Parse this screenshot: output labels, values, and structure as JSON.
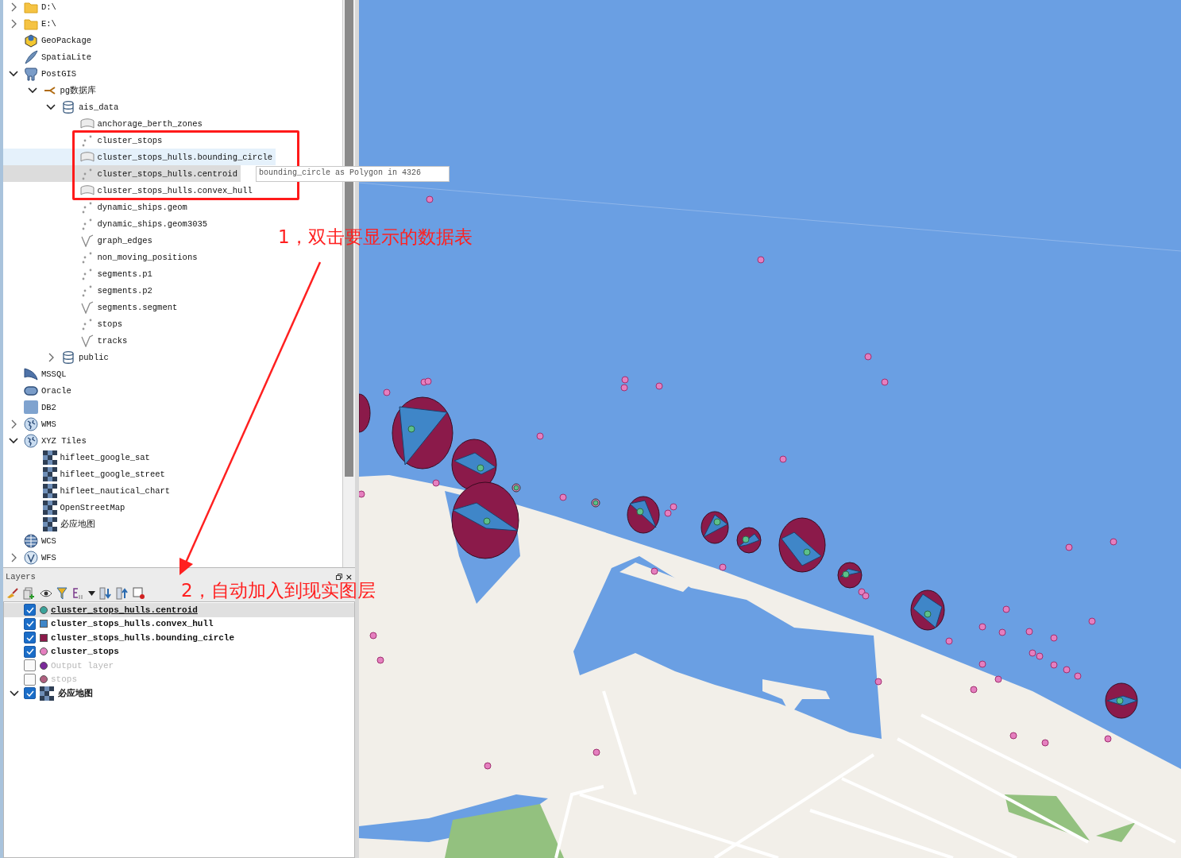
{
  "browser": {
    "tree": [
      {
        "label": "D:\\",
        "kind": "folder",
        "expanded": false
      },
      {
        "label": "E:\\",
        "kind": "folder",
        "expanded": false
      },
      {
        "label": "GeoPackage",
        "kind": "geopackage"
      },
      {
        "label": "SpatiaLite",
        "kind": "spatialite"
      },
      {
        "label": "PostGIS",
        "kind": "postgis",
        "expanded": true,
        "children": [
          {
            "label": "pg数据库",
            "kind": "connection",
            "expanded": true,
            "children": [
              {
                "label": "ais_data",
                "kind": "schema",
                "expanded": true,
                "children": [
                  {
                    "label": "anchorage_berth_zones",
                    "kind": "polygon",
                    "selected": false,
                    "hovered": false
                  },
                  {
                    "label": "cluster_stops",
                    "kind": "point",
                    "selected": false,
                    "hovered": false
                  },
                  {
                    "label": "cluster_stops_hulls.bounding_circle",
                    "kind": "polygon",
                    "selected": false,
                    "hovered": true
                  },
                  {
                    "label": "cluster_stops_hulls.centroid",
                    "kind": "point",
                    "selected": true,
                    "hovered": false
                  },
                  {
                    "label": "cluster_stops_hulls.convex_hull",
                    "kind": "polygon",
                    "selected": false,
                    "hovered": false
                  },
                  {
                    "label": "dynamic_ships.geom",
                    "kind": "point",
                    "selected": false,
                    "hovered": false
                  },
                  {
                    "label": "dynamic_ships.geom3035",
                    "kind": "point",
                    "selected": false,
                    "hovered": false
                  },
                  {
                    "label": "graph_edges",
                    "kind": "line",
                    "selected": false,
                    "hovered": false
                  },
                  {
                    "label": "non_moving_positions",
                    "kind": "point",
                    "selected": false,
                    "hovered": false
                  },
                  {
                    "label": "segments.p1",
                    "kind": "point",
                    "selected": false,
                    "hovered": false
                  },
                  {
                    "label": "segments.p2",
                    "kind": "point",
                    "selected": false,
                    "hovered": false
                  },
                  {
                    "label": "segments.segment",
                    "kind": "line",
                    "selected": false,
                    "hovered": false
                  },
                  {
                    "label": "stops",
                    "kind": "point",
                    "selected": false,
                    "hovered": false
                  },
                  {
                    "label": "tracks",
                    "kind": "line",
                    "selected": false,
                    "hovered": false
                  }
                ]
              },
              {
                "label": "public",
                "kind": "schema",
                "expanded": false
              }
            ]
          }
        ]
      },
      {
        "label": "MSSQL",
        "kind": "mssql"
      },
      {
        "label": "Oracle",
        "kind": "oracle"
      },
      {
        "label": "DB2",
        "kind": "db2"
      },
      {
        "label": "WMS",
        "kind": "globe",
        "expanded": false
      },
      {
        "label": "XYZ Tiles",
        "kind": "globe",
        "expanded": true,
        "children": [
          {
            "label": "hifleet_google_sat",
            "kind": "tiles"
          },
          {
            "label": "hifleet_google_street",
            "kind": "tiles"
          },
          {
            "label": "hifleet_nautical_chart",
            "kind": "tiles"
          },
          {
            "label": "OpenStreetMap",
            "kind": "tiles"
          },
          {
            "label": "必应地图",
            "kind": "tiles"
          }
        ]
      },
      {
        "label": "WCS",
        "kind": "wcs"
      },
      {
        "label": "WFS",
        "kind": "wfs",
        "expanded": false
      }
    ]
  },
  "tooltip": {
    "text": "bounding_circle as Polygon in 4326"
  },
  "layers_panel": {
    "title": "Layers",
    "close": "×",
    "layers": [
      {
        "label": "cluster_stops_hulls.centroid",
        "kind": "point",
        "color": "#3aa39a",
        "checked": true,
        "selected": true
      },
      {
        "label": "cluster_stops_hulls.convex_hull",
        "kind": "polygon",
        "color": "#3f86c8",
        "checked": true,
        "selected": false
      },
      {
        "label": "cluster_stops_hulls.bounding_circle",
        "kind": "polygon",
        "color": "#8b1a4a",
        "checked": true,
        "selected": false
      },
      {
        "label": "cluster_stops",
        "kind": "point",
        "color": "#e57fbf",
        "checked": true,
        "selected": false
      },
      {
        "label": "Output layer",
        "kind": "point",
        "color": "#7b2a9a",
        "checked": false,
        "selected": false
      },
      {
        "label": "stops",
        "kind": "point",
        "color": "#b06080",
        "checked": false,
        "selected": false
      },
      {
        "label": "必应地图",
        "kind": "group",
        "checked": true,
        "selected": false,
        "expanded": true
      }
    ]
  },
  "annotations": [
    {
      "text": "1，双击要显示的数据表"
    },
    {
      "text": "2，自动加入到现实图层"
    }
  ]
}
